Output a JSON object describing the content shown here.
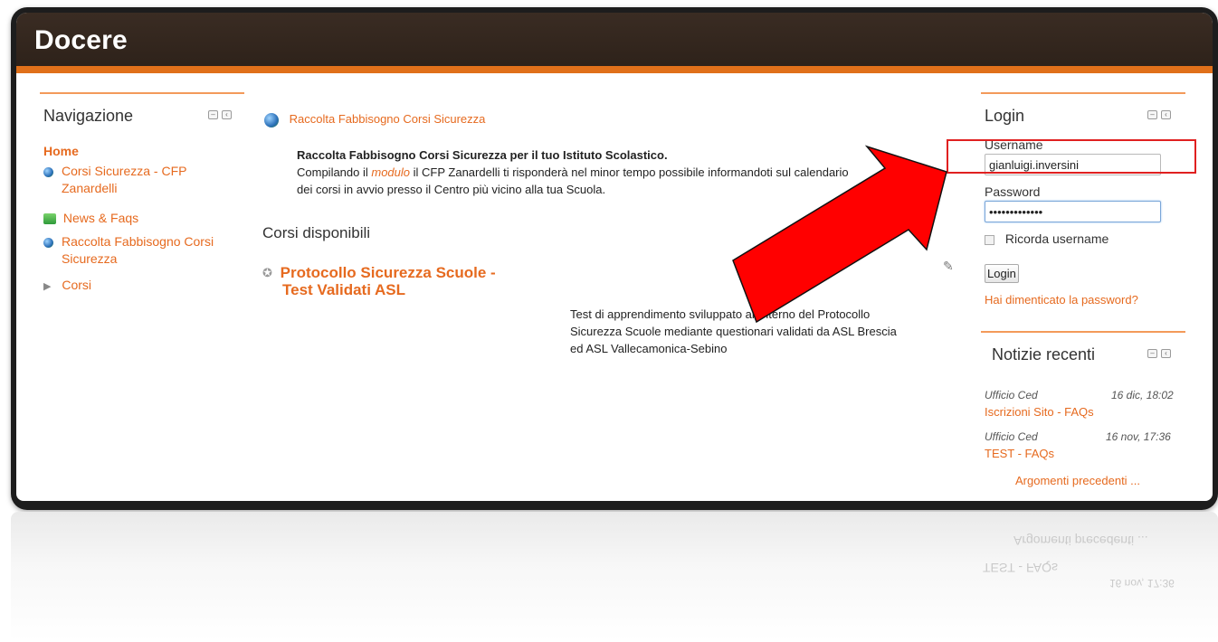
{
  "site": {
    "title": "Docere"
  },
  "navigation": {
    "title": "Navigazione",
    "home": "Home",
    "items": [
      {
        "label": "Corsi Sicurezza - CFP Zanardelli",
        "icon": "globe-icon"
      },
      {
        "label": "News & Faqs",
        "icon": "news-icon"
      },
      {
        "label": "Raccolta Fabbisogno Corsi Sicurezza",
        "icon": "globe-icon"
      },
      {
        "label": "Corsi",
        "icon": "expand-arrow-icon"
      }
    ]
  },
  "main": {
    "link_title": "Raccolta Fabbisogno Corsi Sicurezza",
    "intro_bold": "Raccolta Fabbisogno Corsi Sicurezza per il tuo Istituto Scolastico.",
    "intro_line1_a": "Compilando il ",
    "intro_link": "modulo",
    "intro_line1_b": " il CFP Zanardelli ti risponderà nel minor tempo possibile informandoti sul calendario",
    "intro_line2": "dei corsi in avvio presso il Centro più vicino alla tua Scuola.",
    "courses_heading": "Corsi disponibili",
    "course": {
      "title_line1": "Protocollo Sicurezza Scuole -",
      "title_line2": "Test Validati ASL",
      "desc_line1": "Test di apprendimento sviluppato all'interno del Protocollo",
      "desc_line2": "Sicurezza Scuole mediante questionari validati da ASL Brescia",
      "desc_line3": "ed ASL Vallecamonica-Sebino"
    }
  },
  "login": {
    "title": "Login",
    "username_label": "Username",
    "username_value": "gianluigi.inversini",
    "password_label": "Password",
    "password_value": "•••••••••••••",
    "remember_label": "Ricorda username",
    "button_label": "Login",
    "forgot_link": "Hai dimenticato la password?"
  },
  "news": {
    "title": "Notizie recenti",
    "items": [
      {
        "author": "Ufficio Ced",
        "date": "16 dic, 18:02",
        "title": "Iscrizioni Sito - FAQs"
      },
      {
        "author": "Ufficio Ced",
        "date": "16 nov, 17:36",
        "title": "TEST - FAQs"
      }
    ],
    "older_link": "Argomenti precedenti ..."
  },
  "colors": {
    "accent": "#e66a1f",
    "header_bg": "#33261d",
    "highlight_box": "#e02020",
    "arrow": "#ff0000"
  }
}
